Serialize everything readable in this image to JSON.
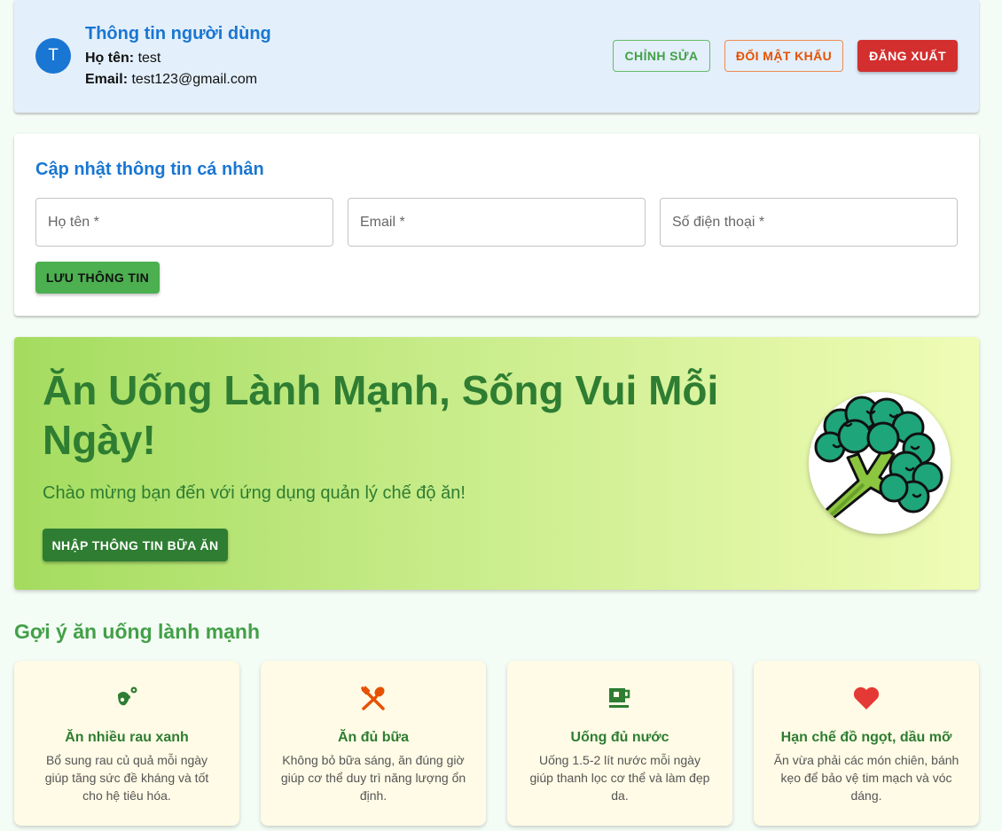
{
  "user": {
    "avatar_letter": "T",
    "title": "Thông tin người dùng",
    "name_label": "Họ tên:",
    "name_value": "test",
    "email_label": "Email:",
    "email_value": "test123@gmail.com",
    "buttons": {
      "edit": "CHỈNH SỬA",
      "change_password": "ĐỔI MẬT KHẨU",
      "logout": "ĐĂNG XUẤT"
    }
  },
  "profile_form": {
    "title": "Cập nhật thông tin cá nhân",
    "fields": {
      "name_placeholder": "Họ tên *",
      "email_placeholder": "Email *",
      "phone_placeholder": "Số điện thoại *"
    },
    "save_label": "LƯU THÔNG TIN"
  },
  "hero": {
    "title": "Ăn Uống Lành Mạnh, Sống Vui Mỗi Ngày!",
    "subtitle": "Chào mừng bạn đến với ứng dụng quản lý chế độ ăn!",
    "cta_label": "NHẬP THÔNG TIN BỮA ĂN",
    "image_icon": "broccoli-icon"
  },
  "tips": {
    "heading": "Gợi ý ăn uống lành mạnh",
    "items": [
      {
        "icon": "vegetables-icon",
        "title": "Ăn nhiều rau xanh",
        "desc": "Bổ sung rau củ quả mỗi ngày giúp tăng sức đề kháng và tốt cho hệ tiêu hóa."
      },
      {
        "icon": "utensils-icon",
        "title": "Ăn đủ bữa",
        "desc": "Không bỏ bữa sáng, ăn đúng giờ giúp cơ thể duy trì năng lượng ổn định."
      },
      {
        "icon": "cup-icon",
        "title": "Uống đủ nước",
        "desc": "Uống 1.5-2 lít nước mỗi ngày giúp thanh lọc cơ thể và làm đẹp da."
      },
      {
        "icon": "heart-icon",
        "title": "Hạn chế đồ ngọt, dầu mỡ",
        "desc": "Ăn vừa phải các món chiên, bánh kẹo để bảo vệ tim mạch và vóc dáng."
      }
    ]
  },
  "colors": {
    "primary_blue": "#1976d2",
    "green_dark": "#2e7d32",
    "green": "#4caf50",
    "logout_red": "#d32f2f",
    "orange": "#e65100"
  }
}
